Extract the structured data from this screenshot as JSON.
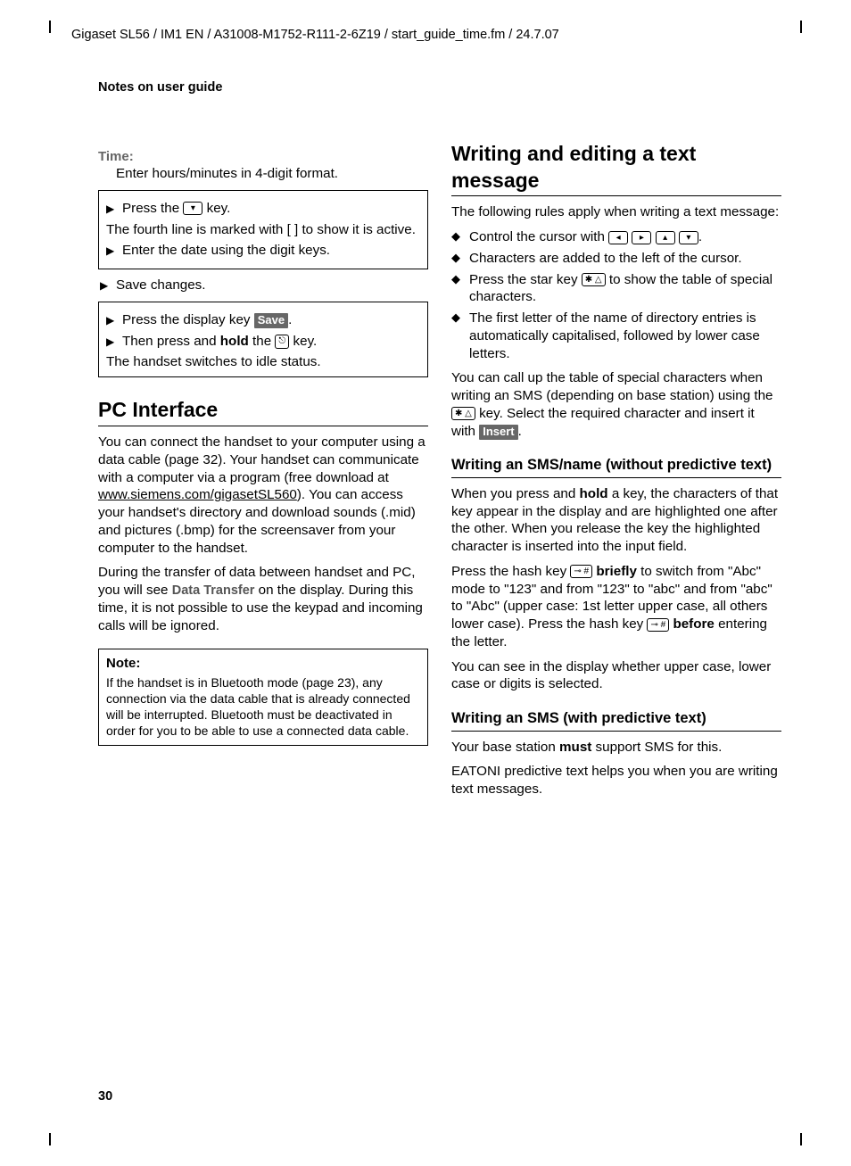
{
  "header": "Gigaset SL56 / IM1 EN / A31008-M1752-R111-2-6Z19 / start_guide_time.fm / 24.7.07",
  "section_label": "Notes on user guide",
  "page_number": "30",
  "left": {
    "time_label": "Time:",
    "time_desc": "Enter hours/minutes in 4-digit format.",
    "box1_press": "Press the ",
    "box1_press_end": " key.",
    "box1_line2": "The fourth line is marked with [  ] to show it is active.",
    "box1_enter": "Enter the date using the digit keys.",
    "save_changes": "Save changes.",
    "box2_press": "Press the display key ",
    "box2_save": "Save",
    "box2_press_end": ".",
    "box2_hold_a": "Then press and ",
    "box2_hold_bold": "hold",
    "box2_hold_b": " the ",
    "box2_hold_end": " key.",
    "box2_idle": "The handset switches to idle status.",
    "pc_title": "PC Interface",
    "pc_p1a": "You can connect the handset to your computer using a data cable (page 32). Your handset can communicate with a computer via a program (free download at ",
    "pc_link": "www.siemens.com/gigasetSL560",
    "pc_p1b": "). You can access your handset's directory and download sounds (.mid) and pictures (.bmp) for the screensaver from your computer to the handset.",
    "pc_p2a": "During the transfer of data between handset and PC, you will see ",
    "data_transfer": "Data Transfer",
    "pc_p2b": " on the display. During this time, it is not possible to use the keypad and incoming calls will be ignored.",
    "note_head": "Note:",
    "note_body": "If the handset is in Bluetooth mode (page 23), any connection via the data cable that is already connected will be interrupted. Bluetooth must be deactivated in order for you to be able to use a connected data cable."
  },
  "right": {
    "title": "Writing and editing a text message",
    "intro": "The following rules apply when writing a text message:",
    "b1": "Control the cursor with ",
    "b1_end": ".",
    "b2": "Characters are added to the left of the cursor.",
    "b3a": "Press the star key ",
    "b3b": " to show the table of special characters.",
    "b4": "The first letter of the name of directory entries is automatically capitalised, followed by lower case letters.",
    "para_a": "You can call up the table of special characters when writing an SMS (depending on base station) using the ",
    "para_b": " key. Select the required character and insert it with ",
    "insert": "Insert",
    "para_end": ".",
    "sub1": "Writing an SMS/name (without predictive text)",
    "sub1_p1a": "When you press and ",
    "sub1_hold": "hold",
    "sub1_p1b": " a key, the characters of that key appear in the display and are highlighted one after the other. When you release the key the highlighted character is inserted into the input field.",
    "sub1_p2a": "Press the hash key ",
    "sub1_briefly": "briefly",
    "sub1_p2b": " to switch from \"Abc\" mode to \"123\" and from \"123\" to \"abc\" and from \"abc\" to \"Abc\" (upper case: 1st letter upper case, all others lower case). Press the hash key ",
    "sub1_before": "before",
    "sub1_p2c": " entering the letter.",
    "sub1_p3": "You can see in the display whether upper case, lower case or digits is selected.",
    "sub2": "Writing an SMS (with predictive text)",
    "sub2_p1a": "Your base station ",
    "sub2_must": "must",
    "sub2_p1b": " support SMS for this.",
    "sub2_p2": "EATONI predictive text helps you when you are writing text messages."
  },
  "keys": {
    "down": "▾",
    "left": "◂",
    "right": "▸",
    "up": "▴",
    "star": "✱ △",
    "hash": "⊸ #"
  }
}
